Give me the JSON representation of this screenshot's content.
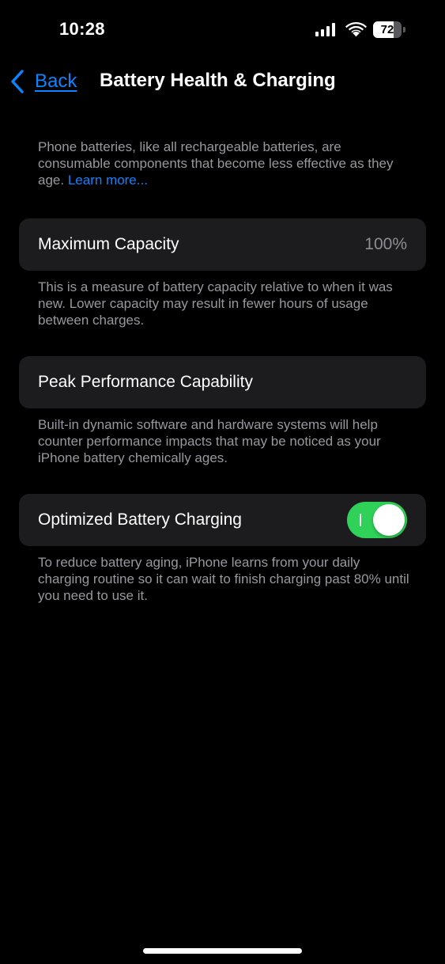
{
  "status_bar": {
    "time": "10:28",
    "battery_level": "72",
    "battery_fraction": 0.72,
    "signal_icon": "cellular-signal-icon",
    "wifi_icon": "wifi-icon",
    "battery_icon": "battery-icon"
  },
  "nav": {
    "back_label": "Back",
    "back_icon": "chevron-left-icon",
    "title": "Battery Health & Charging"
  },
  "intro": {
    "text": "Phone batteries, like all rechargeable batteries, are consumable components that become less effective as they age.",
    "link_label": "Learn more..."
  },
  "maximum_capacity": {
    "label": "Maximum Capacity",
    "value": "100%",
    "footnote": "This is a measure of battery capacity relative to when it was new. Lower capacity may result in fewer hours of usage between charges."
  },
  "peak_performance": {
    "label": "Peak Performance Capability",
    "footnote": "Built-in dynamic software and hardware systems will help counter performance impacts that may be noticed as your iPhone battery chemically ages."
  },
  "optimized_charging": {
    "label": "Optimized Battery Charging",
    "enabled": true,
    "footnote": "To reduce battery aging, iPhone learns from your daily charging routine so it can wait to finish charging past 80% until you need to use it."
  },
  "colors": {
    "background": "#000000",
    "card": "#1c1c1e",
    "accent": "#0a84ff",
    "toggle_on": "#30d158",
    "secondary_text": "#98989e"
  }
}
